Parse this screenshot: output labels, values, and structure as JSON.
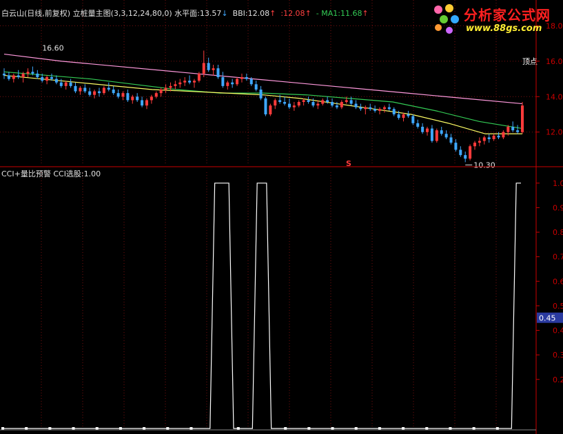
{
  "top_header": {
    "security": "白云山",
    "period": "(日线,前复权)",
    "indicator": "立桩量主图(3,3,12,24,80,0)",
    "level_label": "水平面:",
    "level_value": "13.57",
    "bbi_label": "BBI:",
    "bbi_value": "12.08",
    "sep_value": ":12.08",
    "ma_label": "- MA1:",
    "ma_value": "11.68"
  },
  "bottom_header": {
    "indicator": "CCI+量比预警",
    "signal_label": "CCI选股:",
    "signal_value": "1.00"
  },
  "logo": {
    "title": "分析家公式网",
    "url": "www.88gs.com"
  },
  "annotations": {
    "top_label": "顶点",
    "high_price": "16.60",
    "low_price": "10.30",
    "marker": "S"
  },
  "colors": {
    "up": "#ff3b3b",
    "down": "#3fa8ff",
    "yellow_line": "#ffff66",
    "green_line": "#33cc55",
    "pink_line": "#ff99dd",
    "axis": "#cc0000",
    "current_value_bg": "#2a3aa0"
  },
  "chart_data": [
    {
      "type": "candlestick",
      "title": "",
      "y_axis_ticks": [
        "12.0",
        "14.0",
        "16.0",
        "18.0"
      ],
      "ylim": [
        10.2,
        18.6
      ],
      "grid": true,
      "high_marker": 16.6,
      "low_marker": 10.3,
      "candles": [
        [
          15.3,
          15.6,
          15.0,
          15.2
        ],
        [
          15.2,
          15.4,
          14.9,
          15.0
        ],
        [
          15.0,
          15.3,
          14.8,
          15.2
        ],
        [
          15.2,
          15.5,
          15.0,
          15.1
        ],
        [
          15.1,
          15.4,
          14.8,
          15.3
        ],
        [
          15.3,
          15.6,
          15.1,
          15.4
        ],
        [
          15.4,
          15.7,
          15.2,
          15.3
        ],
        [
          15.3,
          15.5,
          15.0,
          15.1
        ],
        [
          15.1,
          15.3,
          14.8,
          14.9
        ],
        [
          14.9,
          15.2,
          14.7,
          15.1
        ],
        [
          15.1,
          15.3,
          14.9,
          15.0
        ],
        [
          15.0,
          15.2,
          14.7,
          14.8
        ],
        [
          14.8,
          15.0,
          14.5,
          14.6
        ],
        [
          14.6,
          14.9,
          14.4,
          14.8
        ],
        [
          14.8,
          15.0,
          14.5,
          14.6
        ],
        [
          14.6,
          14.8,
          14.2,
          14.3
        ],
        [
          14.3,
          14.6,
          14.1,
          14.5
        ],
        [
          14.5,
          14.7,
          14.2,
          14.3
        ],
        [
          14.3,
          14.5,
          14.0,
          14.1
        ],
        [
          14.1,
          14.4,
          13.9,
          14.3
        ],
        [
          14.3,
          14.5,
          14.0,
          14.2
        ],
        [
          14.2,
          14.6,
          14.1,
          14.5
        ],
        [
          14.5,
          14.8,
          14.3,
          14.4
        ],
        [
          14.4,
          14.6,
          14.1,
          14.2
        ],
        [
          14.2,
          14.4,
          13.9,
          14.0
        ],
        [
          14.0,
          14.3,
          13.8,
          14.2
        ],
        [
          14.2,
          14.4,
          13.7,
          13.8
        ],
        [
          13.8,
          14.1,
          13.6,
          14.0
        ],
        [
          14.0,
          14.2,
          13.7,
          13.8
        ],
        [
          13.8,
          14.0,
          13.4,
          13.5
        ],
        [
          13.5,
          13.9,
          13.3,
          13.8
        ],
        [
          13.8,
          14.1,
          13.6,
          14.0
        ],
        [
          14.0,
          14.3,
          13.9,
          14.2
        ],
        [
          14.2,
          14.5,
          14.0,
          14.4
        ],
        [
          14.4,
          14.7,
          14.2,
          14.5
        ],
        [
          14.5,
          14.8,
          14.3,
          14.6
        ],
        [
          14.6,
          14.9,
          14.4,
          14.7
        ],
        [
          14.7,
          15.0,
          14.5,
          14.8
        ],
        [
          14.8,
          15.1,
          14.6,
          14.9
        ],
        [
          14.9,
          15.2,
          14.7,
          14.8
        ],
        [
          14.8,
          15.0,
          14.5,
          14.9
        ],
        [
          14.9,
          15.4,
          14.8,
          15.3
        ],
        [
          15.3,
          16.6,
          15.1,
          15.9
        ],
        [
          15.9,
          16.2,
          15.4,
          15.5
        ],
        [
          15.5,
          15.8,
          15.2,
          15.6
        ],
        [
          15.6,
          15.8,
          15.0,
          15.1
        ],
        [
          15.1,
          15.4,
          14.5,
          14.6
        ],
        [
          14.6,
          14.9,
          14.4,
          14.8
        ],
        [
          14.8,
          15.0,
          14.5,
          14.7
        ],
        [
          14.7,
          15.1,
          14.6,
          15.0
        ],
        [
          15.0,
          15.3,
          14.8,
          15.1
        ],
        [
          15.1,
          15.3,
          14.9,
          15.0
        ],
        [
          15.0,
          15.1,
          14.6,
          14.7
        ],
        [
          14.7,
          14.9,
          14.3,
          14.4
        ],
        [
          14.4,
          14.6,
          13.8,
          13.9
        ],
        [
          13.9,
          14.0,
          12.9,
          13.0
        ],
        [
          13.0,
          13.6,
          12.9,
          13.5
        ],
        [
          13.5,
          13.9,
          13.3,
          13.8
        ],
        [
          13.8,
          14.1,
          13.6,
          13.7
        ],
        [
          13.7,
          14.0,
          13.5,
          13.6
        ],
        [
          13.6,
          13.9,
          13.3,
          13.4
        ],
        [
          13.4,
          13.7,
          13.2,
          13.5
        ],
        [
          13.5,
          13.8,
          13.4,
          13.7
        ],
        [
          13.7,
          13.9,
          13.5,
          13.8
        ],
        [
          13.8,
          14.0,
          13.6,
          13.7
        ],
        [
          13.7,
          13.9,
          13.4,
          13.5
        ],
        [
          13.5,
          13.8,
          13.3,
          13.6
        ],
        [
          13.6,
          13.9,
          13.5,
          13.8
        ],
        [
          13.8,
          14.0,
          13.6,
          13.7
        ],
        [
          13.7,
          13.9,
          13.4,
          13.5
        ],
        [
          13.5,
          13.7,
          13.3,
          13.4
        ],
        [
          13.4,
          13.8,
          13.3,
          13.7
        ],
        [
          13.7,
          14.0,
          13.6,
          13.8
        ],
        [
          13.8,
          14.0,
          13.5,
          13.6
        ],
        [
          13.6,
          13.8,
          13.3,
          13.4
        ],
        [
          13.4,
          13.6,
          13.2,
          13.3
        ],
        [
          13.3,
          13.5,
          13.0,
          13.4
        ],
        [
          13.4,
          13.6,
          13.2,
          13.3
        ],
        [
          13.3,
          13.5,
          13.1,
          13.2
        ],
        [
          13.2,
          13.4,
          13.0,
          13.3
        ],
        [
          13.3,
          13.5,
          13.1,
          13.4
        ],
        [
          13.4,
          13.6,
          13.2,
          13.3
        ],
        [
          13.3,
          13.4,
          12.9,
          13.0
        ],
        [
          13.0,
          13.2,
          12.7,
          12.8
        ],
        [
          12.8,
          13.1,
          12.6,
          13.0
        ],
        [
          13.0,
          13.2,
          12.8,
          12.9
        ],
        [
          12.9,
          13.0,
          12.4,
          12.5
        ],
        [
          12.5,
          12.7,
          12.2,
          12.3
        ],
        [
          12.3,
          12.5,
          11.9,
          12.0
        ],
        [
          12.0,
          12.3,
          11.8,
          12.2
        ],
        [
          12.2,
          12.4,
          11.4,
          11.5
        ],
        [
          11.5,
          12.2,
          11.4,
          12.1
        ],
        [
          12.1,
          12.3,
          11.8,
          11.9
        ],
        [
          11.9,
          12.1,
          11.6,
          11.7
        ],
        [
          11.7,
          11.9,
          11.3,
          11.4
        ],
        [
          11.4,
          11.6,
          10.9,
          11.0
        ],
        [
          11.0,
          11.2,
          10.6,
          10.7
        ],
        [
          10.7,
          10.9,
          10.3,
          10.5
        ],
        [
          10.5,
          11.3,
          10.4,
          11.2
        ],
        [
          11.2,
          11.5,
          11.0,
          11.4
        ],
        [
          11.4,
          11.7,
          11.2,
          11.5
        ],
        [
          11.5,
          11.8,
          11.3,
          11.7
        ],
        [
          11.7,
          11.9,
          11.4,
          11.6
        ],
        [
          11.6,
          11.9,
          11.5,
          11.8
        ],
        [
          11.8,
          12.0,
          11.6,
          11.7
        ],
        [
          11.7,
          12.1,
          11.6,
          12.0
        ],
        [
          12.0,
          12.4,
          11.8,
          12.3
        ],
        [
          12.3,
          12.6,
          12.0,
          12.1
        ],
        [
          12.1,
          12.4,
          11.9,
          12.0
        ],
        [
          12.0,
          13.7,
          11.9,
          13.5
        ]
      ],
      "series": [
        {
          "values": [
            16.4,
            16.0,
            15.7,
            15.4,
            15.1,
            14.8,
            14.5,
            14.2,
            13.9,
            13.6
          ]
        },
        {
          "values": [
            15.4,
            15.2,
            15.0,
            14.7,
            14.4,
            14.2,
            14.2,
            14.1,
            13.9,
            13.7,
            13.2,
            12.6,
            12.2
          ]
        },
        {
          "values": [
            15.2,
            15.0,
            14.8,
            14.6,
            14.4,
            14.3,
            14.2,
            14.1,
            13.9,
            13.6,
            13.3,
            13.0,
            12.5,
            11.9,
            11.9
          ]
        }
      ]
    },
    {
      "type": "line",
      "title": "",
      "y_axis_ticks": [
        "0.2",
        "0.3",
        "0.4",
        "0.5",
        "0.6",
        "0.7",
        "0.8",
        "0.9",
        "1.0"
      ],
      "ylim": [
        0,
        1.05
      ],
      "current_value_label": "0.45",
      "x": [
        0,
        1,
        2,
        3,
        4,
        5,
        6,
        7,
        8,
        9,
        10,
        11,
        12,
        13,
        14,
        15,
        16,
        17,
        18,
        19,
        20,
        21,
        22,
        23,
        24,
        25,
        26,
        27,
        28,
        29,
        30,
        31,
        32,
        33,
        34,
        35,
        36,
        37,
        38,
        39,
        40,
        41,
        42,
        43,
        44,
        45,
        46,
        47,
        48,
        49,
        50,
        51,
        52,
        53,
        54,
        55,
        56,
        57,
        58,
        59,
        60,
        61,
        62,
        63,
        64,
        65,
        66,
        67,
        68,
        69,
        70,
        71,
        72,
        73,
        74,
        75,
        76,
        77,
        78,
        79,
        80,
        81,
        82,
        83,
        84,
        85,
        86,
        87,
        88,
        89,
        90,
        91,
        92,
        93,
        94,
        95,
        96,
        97,
        98,
        99,
        100,
        101,
        102,
        103,
        104,
        105,
        106,
        107,
        108,
        109,
        110
      ],
      "values": [
        0,
        0,
        0,
        0,
        0,
        0,
        0,
        0,
        0,
        0,
        0,
        0,
        0,
        0,
        0,
        0,
        0,
        0,
        0,
        0,
        0,
        0,
        0,
        0,
        0,
        0,
        0,
        0,
        0,
        0,
        0,
        0,
        0,
        0,
        0,
        0,
        0,
        0,
        0,
        0,
        0,
        0,
        0,
        0,
        0,
        1,
        1,
        1,
        1,
        0,
        0,
        0,
        0,
        0,
        1,
        1,
        1,
        0,
        0,
        0,
        0,
        0,
        0,
        0,
        0,
        0,
        0,
        0,
        0,
        0,
        0,
        0,
        0,
        0,
        0,
        0,
        0,
        0,
        0,
        0,
        0,
        0,
        0,
        0,
        0,
        0,
        0,
        0,
        0,
        0,
        0,
        0,
        0,
        0,
        0,
        0,
        0,
        0,
        0,
        0,
        0,
        0,
        0,
        0,
        0,
        0,
        0,
        0,
        0,
        1,
        1
      ]
    }
  ]
}
